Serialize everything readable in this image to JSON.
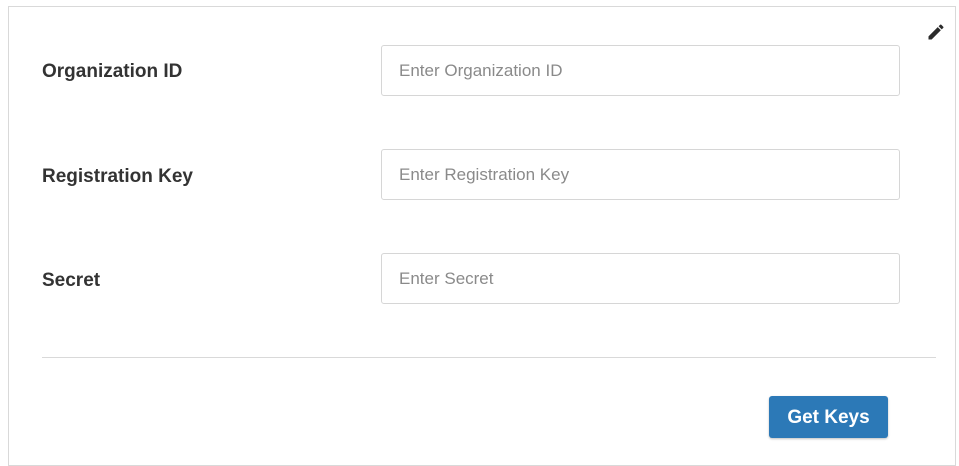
{
  "form": {
    "fields": [
      {
        "label": "Organization ID",
        "placeholder": "Enter Organization ID",
        "value": ""
      },
      {
        "label": "Registration Key",
        "placeholder": "Enter Registration Key",
        "value": ""
      },
      {
        "label": "Secret",
        "placeholder": "Enter Secret",
        "value": ""
      }
    ],
    "submit_label": "Get Keys"
  },
  "icons": {
    "edit": "pencil-icon"
  },
  "colors": {
    "button": "#2c79b7",
    "label_text": "#333333",
    "placeholder_text": "#8a8a8a",
    "border": "#d6d6d6"
  }
}
